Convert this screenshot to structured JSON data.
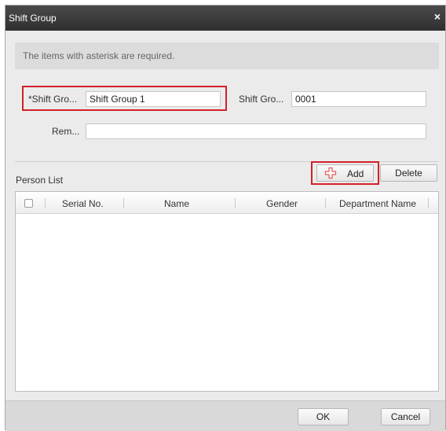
{
  "window": {
    "title": "Shift Group",
    "close_glyph": "×"
  },
  "notice": {
    "text": "The items with asterisk are required."
  },
  "form": {
    "group_name_label": "*Shift Gro...",
    "group_name_value": "Shift Group 1",
    "group_no_label": "Shift Gro...",
    "group_no_value": "0001",
    "remark_label": "Rem...",
    "remark_value": ""
  },
  "person_list": {
    "label": "Person List",
    "add_label": "Add",
    "delete_label": "Delete",
    "columns": [
      "Serial No.",
      "Name",
      "Gender",
      "Department Name"
    ],
    "rows": []
  },
  "footer": {
    "ok_label": "OK",
    "cancel_label": "Cancel"
  },
  "colors": {
    "highlight": "#d4202a",
    "add_icon": "#e05a5a"
  },
  "icons": {
    "close": "close-icon",
    "add": "plus-icon",
    "checkbox": "select-all-checkbox"
  }
}
